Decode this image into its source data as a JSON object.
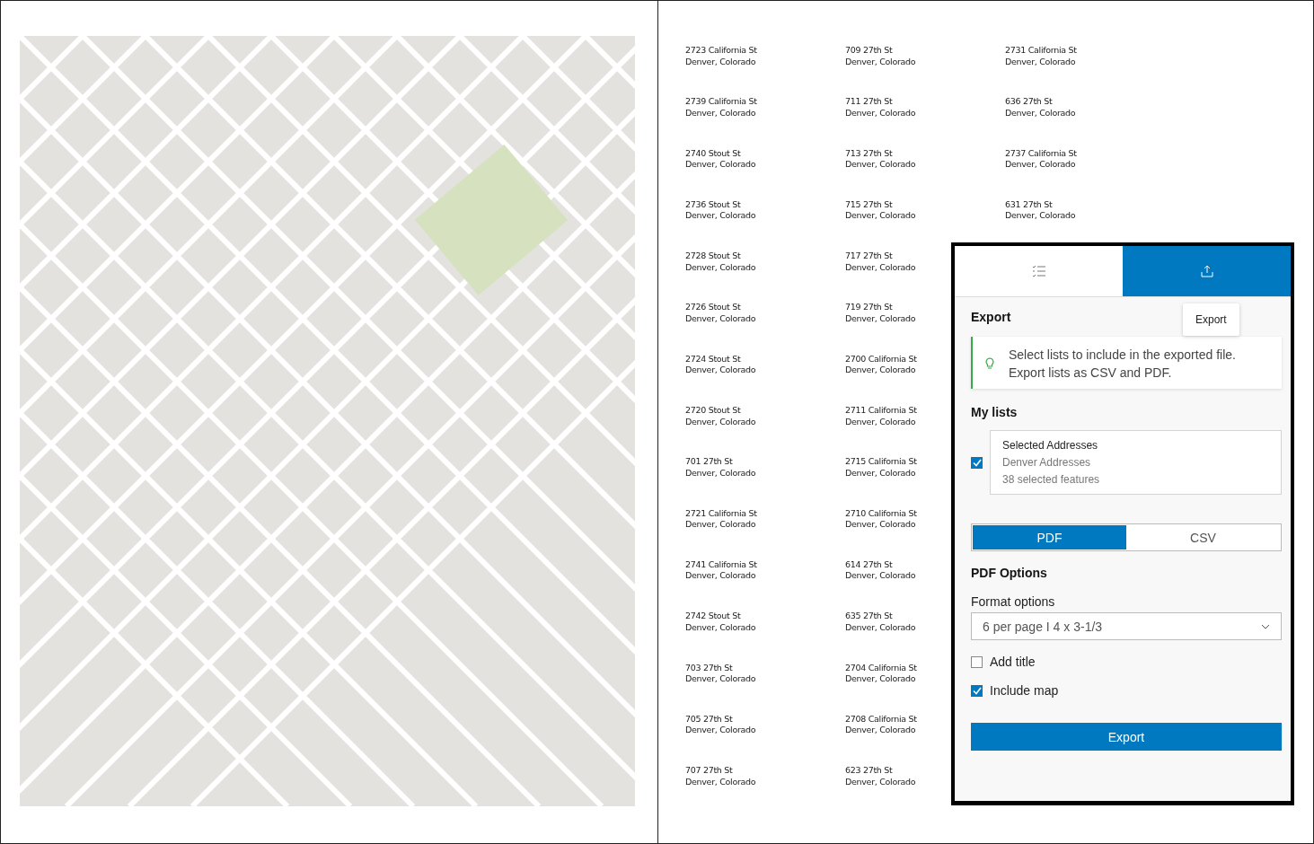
{
  "address_columns": [
    [
      {
        "street": "2723 California St",
        "city": "Denver, Colorado"
      },
      {
        "street": "2739 California St",
        "city": "Denver, Colorado"
      },
      {
        "street": "2740 Stout St",
        "city": "Denver, Colorado"
      },
      {
        "street": "2736 Stout St",
        "city": "Denver, Colorado"
      },
      {
        "street": "2728 Stout St",
        "city": "Denver, Colorado"
      },
      {
        "street": "2726 Stout St",
        "city": "Denver, Colorado"
      },
      {
        "street": "2724 Stout St",
        "city": "Denver, Colorado"
      },
      {
        "street": "2720 Stout St",
        "city": "Denver, Colorado"
      },
      {
        "street": "701 27th St",
        "city": "Denver, Colorado"
      },
      {
        "street": "2721 California St",
        "city": "Denver, Colorado"
      },
      {
        "street": "2741 California St",
        "city": "Denver, Colorado"
      },
      {
        "street": "2742 Stout St",
        "city": "Denver, Colorado"
      },
      {
        "street": "703 27th St",
        "city": "Denver, Colorado"
      },
      {
        "street": "705 27th St",
        "city": "Denver, Colorado"
      },
      {
        "street": "707 27th St",
        "city": "Denver, Colorado"
      }
    ],
    [
      {
        "street": "709 27th St",
        "city": "Denver, Colorado"
      },
      {
        "street": "711 27th St",
        "city": "Denver, Colorado"
      },
      {
        "street": "713 27th St",
        "city": "Denver, Colorado"
      },
      {
        "street": "715 27th St",
        "city": "Denver, Colorado"
      },
      {
        "street": "717 27th St",
        "city": "Denver, Colorado"
      },
      {
        "street": "719 27th St",
        "city": "Denver, Colorado"
      },
      {
        "street": "2700 California St",
        "city": "Denver, Colorado"
      },
      {
        "street": "2711 California St",
        "city": "Denver, Colorado"
      },
      {
        "street": "2715 California St",
        "city": "Denver, Colorado"
      },
      {
        "street": "2710 California St",
        "city": "Denver, Colorado"
      },
      {
        "street": "614 27th St",
        "city": "Denver, Colorado"
      },
      {
        "street": "635 27th St",
        "city": "Denver, Colorado"
      },
      {
        "street": "2704 California St",
        "city": "Denver, Colorado"
      },
      {
        "street": "2708 California St",
        "city": "Denver, Colorado"
      },
      {
        "street": "623 27th St",
        "city": "Denver, Colorado"
      }
    ],
    [
      {
        "street": "2731 California St",
        "city": "Denver, Colorado"
      },
      {
        "street": "636 27th St",
        "city": "Denver, Colorado"
      },
      {
        "street": "2737 California St",
        "city": "Denver, Colorado"
      },
      {
        "street": "631 27th St",
        "city": "Denver, Colorado"
      }
    ]
  ],
  "panel": {
    "tabs": [
      {
        "kind": "list",
        "selected": false
      },
      {
        "kind": "export",
        "selected": true
      }
    ],
    "tooltip": "Export",
    "heading": "Export",
    "notice": [
      "Select lists to include in the exported file.",
      "Export lists as CSV and PDF."
    ],
    "my_lists_title": "My lists",
    "lists": [
      {
        "title": "Selected Addresses",
        "source": "Denver Addresses",
        "count": "38 selected features",
        "checked": true
      }
    ],
    "format_tabs": [
      {
        "label": "PDF",
        "selected": true
      },
      {
        "label": "CSV",
        "selected": false
      }
    ],
    "options_title": "PDF Options",
    "format_label": "Format options",
    "format_value": "6 per page I 4 x 3-1/3",
    "checkboxes": [
      {
        "label": "Add title",
        "checked": false
      },
      {
        "label": "Include map",
        "checked": true
      }
    ],
    "export_button": "Export"
  }
}
